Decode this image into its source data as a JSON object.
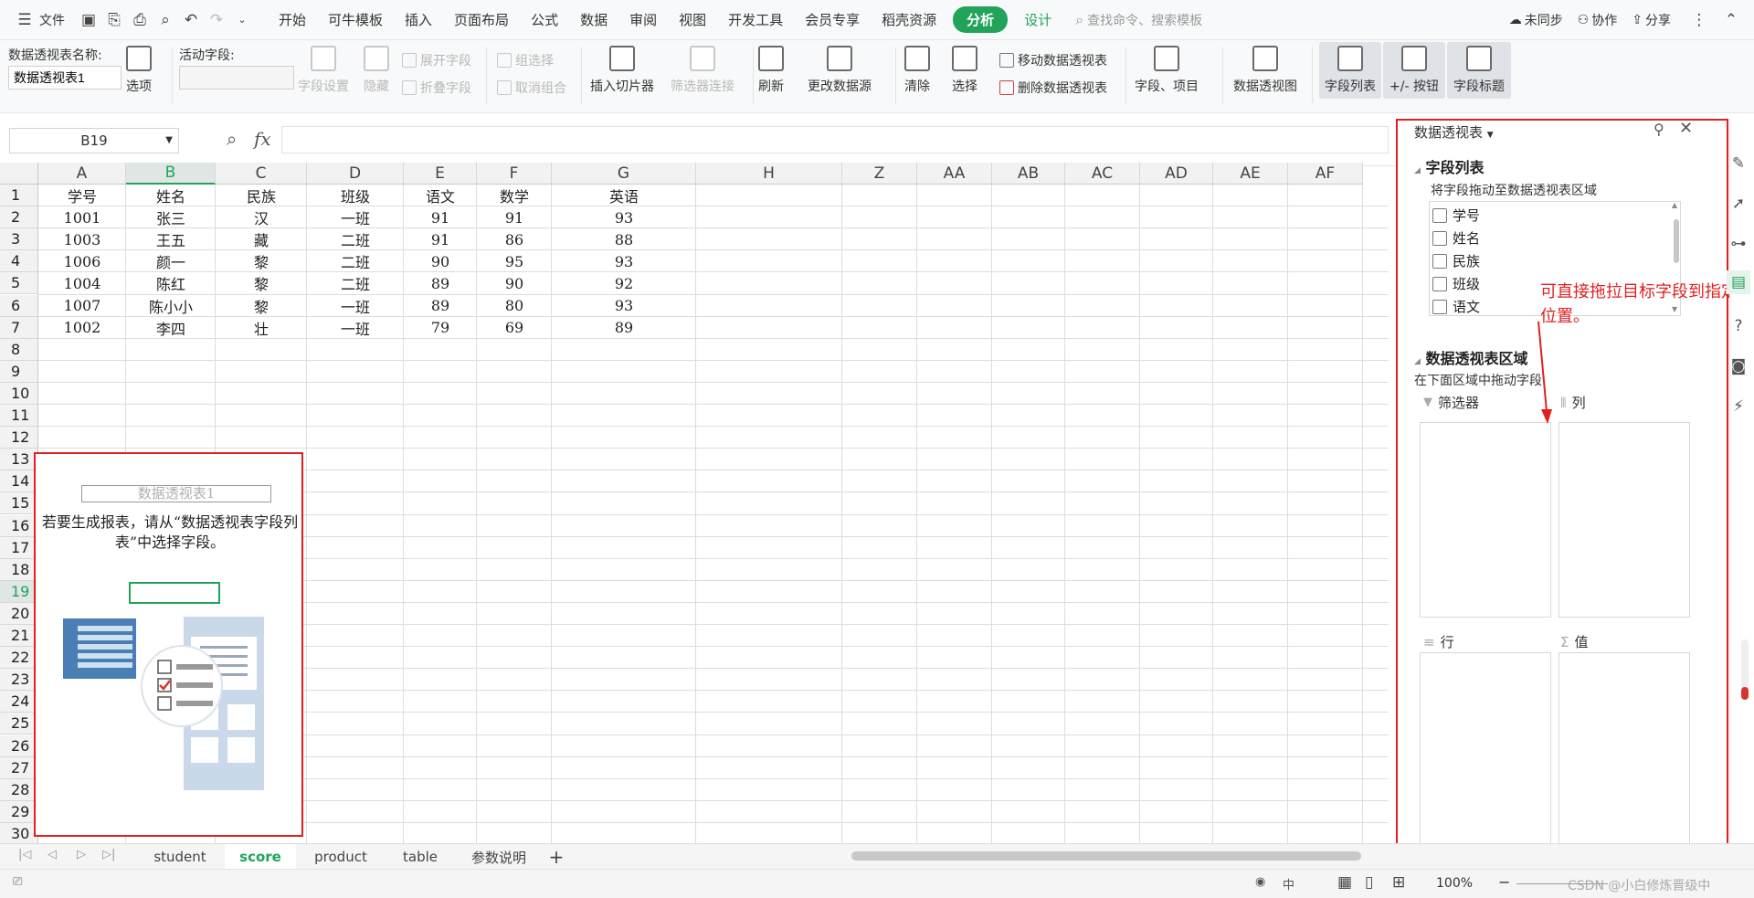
{
  "menubar": {
    "file": "文件",
    "tabs": [
      "开始",
      "可牛模板",
      "插入",
      "页面布局",
      "公式",
      "数据",
      "审阅",
      "视图",
      "开发工具",
      "会员专享",
      "稻壳资源"
    ],
    "active_tab": "分析",
    "design_tab": "设计",
    "search_placeholder": "查找命令、搜索模板",
    "sync": "未同步",
    "collab": "协作",
    "share": "分享"
  },
  "ribbon": {
    "pivot_name_label": "数据透视表名称:",
    "pivot_name_value": "数据透视表1",
    "options": "选项",
    "active_field_label": "活动字段:",
    "field_settings": "字段设置",
    "hide": "隐藏",
    "expand_field": "展开字段",
    "collapse_field": "折叠字段",
    "group_select": "组选择",
    "ungroup": "取消组合",
    "insert_slicer": "插入切片器",
    "filter_connect": "筛选器连接",
    "refresh": "刷新",
    "change_source": "更改数据源",
    "clear": "清除",
    "select": "选择",
    "move_pivot": "移动数据透视表",
    "delete_pivot": "删除数据透视表",
    "fields_items": "字段、项目",
    "pivot_chart": "数据透视图",
    "field_list": "字段列表",
    "plus_minus": "+/- 按钮",
    "field_headers": "字段标题"
  },
  "formula_bar": {
    "name_box": "B19",
    "fx": "fx",
    "value": ""
  },
  "sheet": {
    "columns": [
      "A",
      "B",
      "C",
      "D",
      "E",
      "F",
      "G",
      "H",
      "Z",
      "AA",
      "AB",
      "AC",
      "AD",
      "AE",
      "AF"
    ],
    "selected_column": "B",
    "selected_row": "19",
    "row_numbers": [
      "1",
      "2",
      "3",
      "4",
      "5",
      "6",
      "7",
      "8",
      "9",
      "10",
      "11",
      "12",
      "13",
      "14",
      "15",
      "16",
      "17",
      "18",
      "19",
      "20",
      "21",
      "22",
      "23",
      "24",
      "25",
      "26",
      "27",
      "28",
      "29",
      "30"
    ],
    "header_row": [
      "学号",
      "姓名",
      "民族",
      "班级",
      "语文",
      "数学",
      "英语"
    ],
    "rows": [
      [
        "1001",
        "张三",
        "汉",
        "一班",
        "91",
        "91",
        "93"
      ],
      [
        "1003",
        "王五",
        "藏",
        "二班",
        "91",
        "86",
        "88"
      ],
      [
        "1006",
        "颜一",
        "黎",
        "二班",
        "90",
        "95",
        "93"
      ],
      [
        "1004",
        "陈红",
        "黎",
        "二班",
        "89",
        "90",
        "92"
      ],
      [
        "1007",
        "陈小小",
        "黎",
        "一班",
        "89",
        "80",
        "93"
      ],
      [
        "1002",
        "李四",
        "壮",
        "一班",
        "79",
        "69",
        "89"
      ]
    ]
  },
  "pivot_placeholder": {
    "title": "数据透视表1",
    "hint": "若要生成报表，请从“数据透视表字段列表”中选择字段。"
  },
  "pane": {
    "header": "数据透视表",
    "field_list_title": "字段列表",
    "field_list_hint": "将字段拖动至数据透视表区域",
    "fields": [
      "学号",
      "姓名",
      "民族",
      "班级",
      "语文"
    ],
    "areas_title": "数据透视表区域",
    "areas_hint": "在下面区域中拖动字段",
    "filter_label": "筛选器",
    "column_label": "列",
    "row_label": "行",
    "value_label": "值",
    "annotation": "可直接拖拉目标字段到指定位置。"
  },
  "tabs": {
    "sheets": [
      "student",
      "score",
      "product",
      "table",
      "参数说明"
    ],
    "active": "score",
    "add": "+"
  },
  "status": {
    "zoom": "100%",
    "watermark": "CSDN @小白修炼晋级中"
  },
  "colors": {
    "accent": "#21a35a",
    "annotation_red": "#e02020",
    "grid_line": "#dadde4"
  }
}
